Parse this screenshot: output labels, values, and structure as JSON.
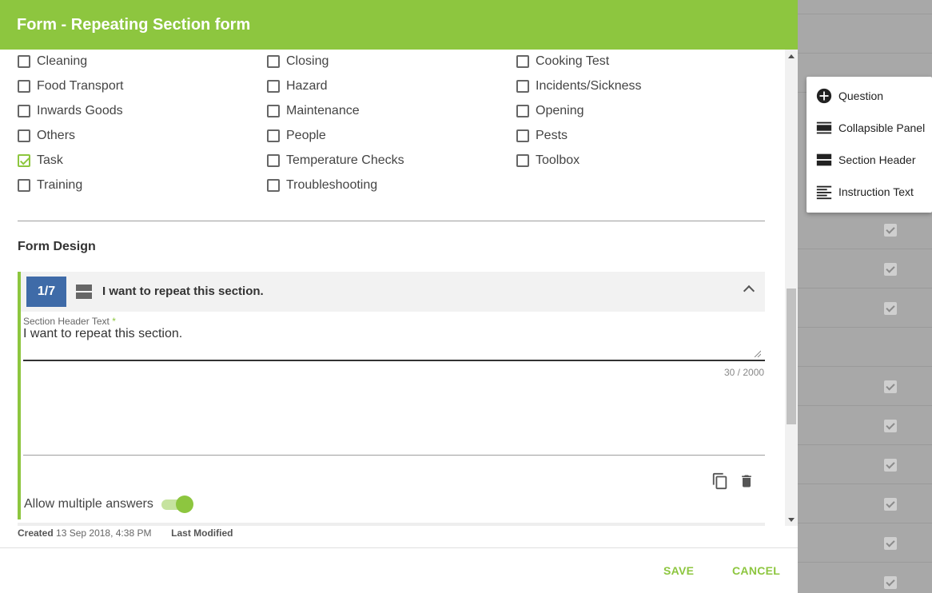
{
  "dialog": {
    "title": "Form - Repeating Section form"
  },
  "categories": [
    {
      "label": "Cleaning",
      "checked": false
    },
    {
      "label": "Closing",
      "checked": false
    },
    {
      "label": "Cooking Test",
      "checked": false
    },
    {
      "label": "Food Transport",
      "checked": false
    },
    {
      "label": "Hazard",
      "checked": false
    },
    {
      "label": "Incidents/Sickness",
      "checked": false
    },
    {
      "label": "Inwards Goods",
      "checked": false
    },
    {
      "label": "Maintenance",
      "checked": false
    },
    {
      "label": "Opening",
      "checked": false
    },
    {
      "label": "Others",
      "checked": false
    },
    {
      "label": "People",
      "checked": false
    },
    {
      "label": "Pests",
      "checked": false
    },
    {
      "label": "Task",
      "checked": true
    },
    {
      "label": "Temperature Checks",
      "checked": false
    },
    {
      "label": "Toolbox",
      "checked": false
    },
    {
      "label": "Training",
      "checked": false
    },
    {
      "label": "Troubleshooting",
      "checked": false
    }
  ],
  "form_design": {
    "title": "Form Design",
    "section": {
      "index": "1/7",
      "heading": "I want to repeat this section.",
      "field_label": "Section Header Text",
      "required_mark": "*",
      "field_value": "I want to repeat this section.",
      "counter": "30 / 2000",
      "allow_multiple_label": "Allow multiple answers",
      "allow_multiple": true
    }
  },
  "meta": {
    "created_label": "Created",
    "created_value": "13 Sep 2018, 4:38 PM",
    "modified_label": "Last Modified"
  },
  "buttons": {
    "save": "SAVE",
    "cancel": "CANCEL"
  },
  "menu": {
    "items": [
      {
        "label": "Question",
        "icon": "plus-circle-icon"
      },
      {
        "label": "Collapsible Panel",
        "icon": "collapsible-panel-icon"
      },
      {
        "label": "Section Header",
        "icon": "section-header-icon"
      },
      {
        "label": "Instruction Text",
        "icon": "text-align-icon"
      }
    ]
  },
  "colors": {
    "accent": "#8dc63f",
    "badge": "#3f6ba8"
  }
}
